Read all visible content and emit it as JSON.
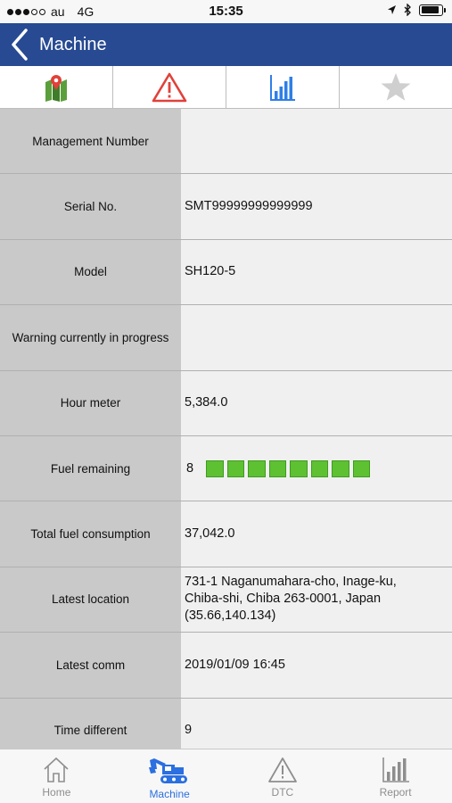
{
  "status_bar": {
    "carrier": "au",
    "network": "4G",
    "time": "15:35",
    "signal_bars_filled": 3,
    "signal_bars_total": 5
  },
  "nav": {
    "title": "Machine",
    "back_icon": "chevron-left-icon"
  },
  "top_tabs": [
    {
      "icon": "map-icon"
    },
    {
      "icon": "warning-icon"
    },
    {
      "icon": "bar-chart-icon"
    },
    {
      "icon": "star-icon"
    }
  ],
  "info_rows": [
    {
      "label": "Management Number",
      "value": ""
    },
    {
      "label": "Serial No.",
      "value": "SMT99999999999999"
    },
    {
      "label": "Model",
      "value": "SH120-5"
    },
    {
      "label": "Warning currently in progress",
      "value": ""
    },
    {
      "label": "Hour meter",
      "value": "5,384.0"
    },
    {
      "label": "Fuel remaining",
      "value": "8"
    },
    {
      "label": "Total fuel consumption",
      "value": "37,042.0"
    },
    {
      "label": "Latest location",
      "value": "731-1 Naganumahara-cho, Inage-ku, Chiba-shi, Chiba 263-0001, Japan (35.66,140.134)"
    },
    {
      "label": "Latest comm",
      "value": "2019/01/09 16:45"
    },
    {
      "label": "Time different",
      "value": "9"
    }
  ],
  "fuel_level": {
    "filled": 8,
    "total": 8,
    "color": "#5ec132"
  },
  "bottom_tabs": [
    {
      "label": "Home",
      "icon": "home-icon",
      "active": false
    },
    {
      "label": "Machine",
      "icon": "excavator-icon",
      "active": true
    },
    {
      "label": "DTC",
      "icon": "warning-icon",
      "active": false
    },
    {
      "label": "Report",
      "icon": "bar-chart-icon",
      "active": false
    }
  ],
  "colors": {
    "nav_bg": "#274a92",
    "label_bg": "#c9c9c9",
    "value_bg": "#f0f0f0",
    "active_tab": "#2b6fe0",
    "warning_red": "#e0413a",
    "chart_blue": "#2f7fe6"
  }
}
